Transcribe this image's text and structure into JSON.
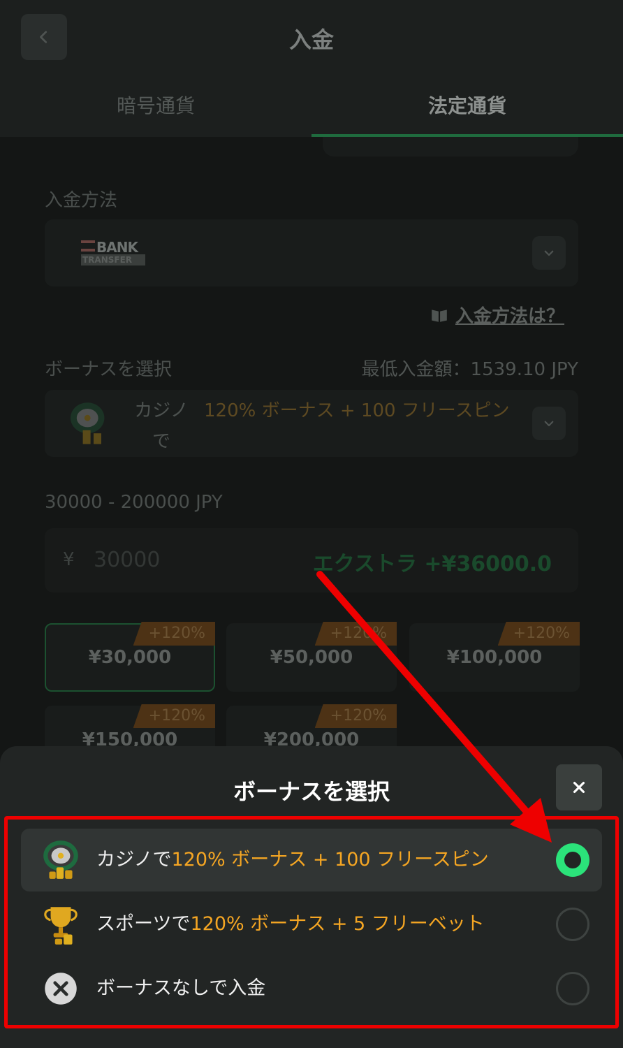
{
  "header": {
    "title": "入金"
  },
  "tabs": [
    {
      "label": "暗号通貨",
      "active": false
    },
    {
      "label": "法定通貨",
      "active": true
    }
  ],
  "deposit_method": {
    "label": "入金方法",
    "selected_logo_top": "BANK",
    "selected_logo_bottom": "TRANSFER",
    "help_link": "入金方法は？"
  },
  "bonus": {
    "label": "ボーナスを選択",
    "min_deposit": "最低入金額：1539.10 JPY",
    "selected_prefix": "カジノで",
    "selected_highlight": "120% ボーナス + 100 フリースピン"
  },
  "amount": {
    "range": "30000 - 200000 JPY",
    "currency_symbol": "¥",
    "placeholder": "30000",
    "extra": "エクストラ +¥36000.0"
  },
  "quick_amounts": [
    {
      "value": "¥30,000",
      "badge": "+120%",
      "selected": true
    },
    {
      "value": "¥50,000",
      "badge": "+120%",
      "selected": false
    },
    {
      "value": "¥100,000",
      "badge": "+120%",
      "selected": false
    },
    {
      "value": "¥150,000",
      "badge": "+120%",
      "selected": false
    },
    {
      "value": "¥200,000",
      "badge": "+120%",
      "selected": false
    }
  ],
  "sheet": {
    "title": "ボーナスを選択",
    "options": [
      {
        "icon": "roulette-icon",
        "prefix": "カジノで",
        "highlight": "120% ボーナス + 100 フリースピン",
        "selected": true
      },
      {
        "icon": "trophy-icon",
        "prefix": "スポーツで",
        "highlight": "120% ボーナス + 5 フリーベット",
        "selected": false
      },
      {
        "icon": "close-circle-icon",
        "prefix": "ボーナスなしで入金",
        "highlight": "",
        "selected": false
      }
    ]
  },
  "colors": {
    "accent_green": "#2be37a",
    "highlight_orange": "#f5a623",
    "annotation_red": "#ee0000"
  }
}
